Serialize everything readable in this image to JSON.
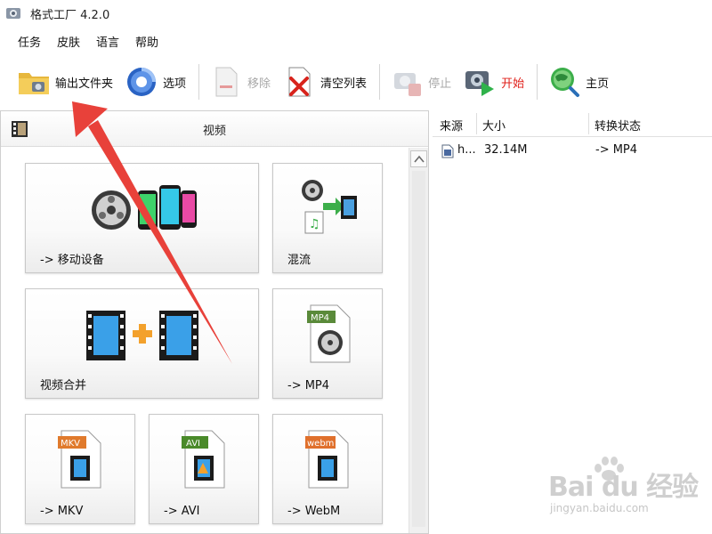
{
  "app": {
    "title": "格式工厂 4.2.0",
    "icon": "format-factory-logo"
  },
  "menu": [
    "任务",
    "皮肤",
    "语言",
    "帮助"
  ],
  "toolbar": {
    "output_folder": "输出文件夹",
    "options": "选项",
    "remove": "移除",
    "clear_list": "清空列表",
    "stop": "停止",
    "start": "开始",
    "home": "主页"
  },
  "left_panel": {
    "header": "视频",
    "tiles": {
      "mobile": "-> 移动设备",
      "mux": "混流",
      "join": "视频合并",
      "mp4": "-> MP4",
      "mkv": "-> MKV",
      "avi": "-> AVI",
      "webm": "-> WebM"
    },
    "badges": {
      "mp4": "MP4",
      "mkv": "MKV",
      "avi": "AVI",
      "webm": "webm"
    }
  },
  "task_list": {
    "columns": [
      "来源",
      "大小",
      "转换状态"
    ],
    "rows": [
      {
        "source": "h...",
        "size": "32.14M",
        "status": "-> MP4"
      }
    ]
  },
  "watermark": {
    "main": "Bai du 经验",
    "sub": "jingyan.baidu.com"
  },
  "colors": {
    "start_text": "#e0201a",
    "disabled_text": "#a8a8a8",
    "arrow": "#e8413a"
  }
}
